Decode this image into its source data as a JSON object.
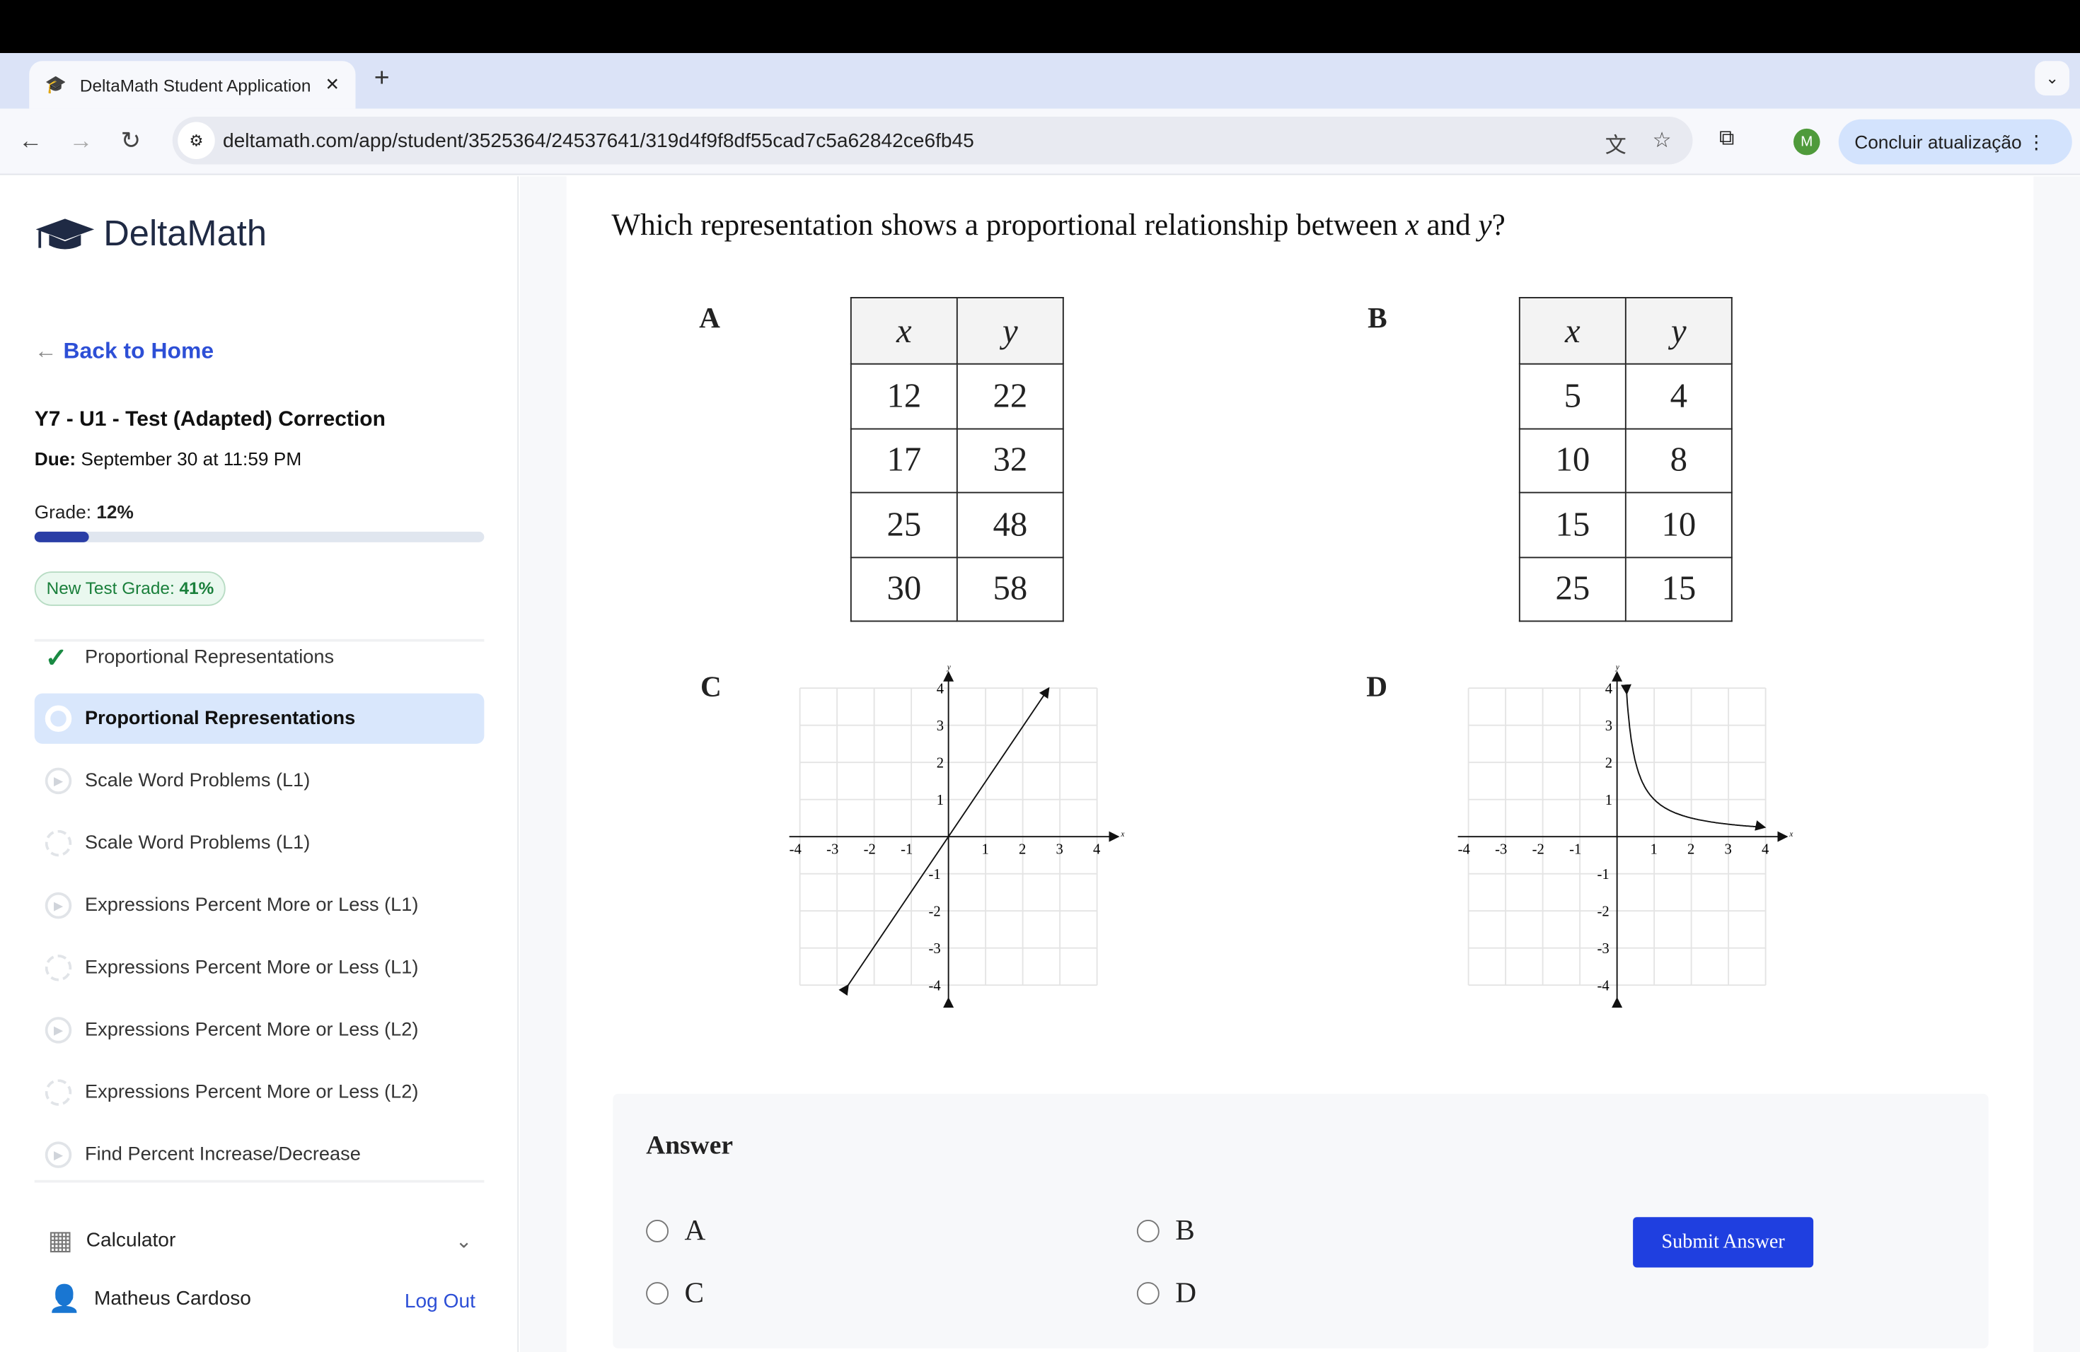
{
  "browser": {
    "tab_title": "DeltaMath Student Application",
    "url": "deltamath.com/app/student/3525364/24537641/319d4f9f8df55cad7c5a62842ce6fb45",
    "update_label": "Concluir atualização",
    "profile_initial": "M"
  },
  "sidebar": {
    "logo": "DeltaMath",
    "back": "Back to Home",
    "assignment_title": "Y7 - U1 - Test (Adapted) Correction",
    "due_label": "Due:",
    "due_value": "September 30 at 11:59 PM",
    "grade_label": "Grade:",
    "grade_value": "12%",
    "grade_progress": 12,
    "new_grade_label": "New Test Grade:",
    "new_grade_value": "41%",
    "items": [
      {
        "label": "Proportional Representations",
        "status": "complete"
      },
      {
        "label": "Proportional Representations",
        "status": "active"
      },
      {
        "label": "Scale Word Problems (L1)",
        "status": "video"
      },
      {
        "label": "Scale Word Problems (L1)",
        "status": "pending"
      },
      {
        "label": "Expressions Percent More or Less (L1)",
        "status": "video"
      },
      {
        "label": "Expressions Percent More or Less (L1)",
        "status": "pending"
      },
      {
        "label": "Expressions Percent More or Less (L2)",
        "status": "video"
      },
      {
        "label": "Expressions Percent More or Less (L2)",
        "status": "pending"
      },
      {
        "label": "Find Percent Increase/Decrease",
        "status": "video"
      }
    ],
    "calculator": "Calculator",
    "user_name": "Matheus Cardoso",
    "logout": "Log Out"
  },
  "question": {
    "text_pre": "Which representation shows a proportional relationship between ",
    "var_x": "x",
    "text_mid": " and ",
    "var_y": "y",
    "text_post": "?",
    "table_a": {
      "label": "A",
      "headers": [
        "x",
        "y"
      ],
      "rows": [
        [
          "12",
          "22"
        ],
        [
          "17",
          "32"
        ],
        [
          "25",
          "48"
        ],
        [
          "30",
          "58"
        ]
      ]
    },
    "table_b": {
      "label": "B",
      "headers": [
        "x",
        "y"
      ],
      "rows": [
        [
          "5",
          "4"
        ],
        [
          "10",
          "8"
        ],
        [
          "15",
          "10"
        ],
        [
          "25",
          "15"
        ]
      ]
    },
    "graph_c": {
      "label": "C",
      "description_type": "line",
      "points": [
        [
          -2.7,
          -4
        ],
        [
          2.7,
          4
        ]
      ]
    },
    "graph_d": {
      "label": "D",
      "description_type": "curve y=1/x"
    },
    "axis_ticks": [
      "-4",
      "-3",
      "-2",
      "-1",
      "1",
      "2",
      "3",
      "4"
    ]
  },
  "answer": {
    "heading": "Answer",
    "options": [
      "A",
      "B",
      "C",
      "D"
    ],
    "submit": "Submit Answer"
  }
}
